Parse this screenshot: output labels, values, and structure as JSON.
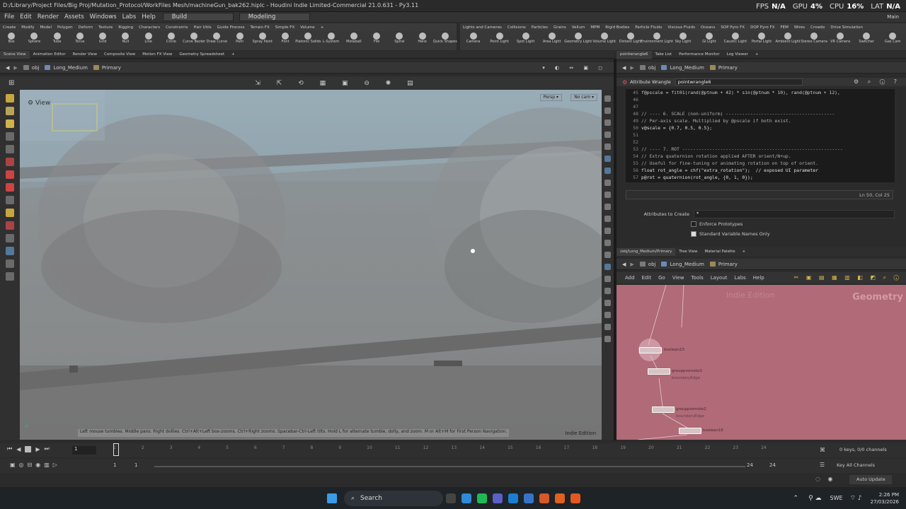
{
  "titlebar": {
    "text": "D:/Library/Project Files/Big Proj/Mutation_Protocol/WorkFiles Mesh/machineGun_bak262.hiplc - Houdini Indie Limited-Commercial 21.0.631 - Py3.11",
    "fps_label": "FPS",
    "fps_value": "N/A",
    "gpu_label": "GPU",
    "gpu_value": "4%",
    "cpu_label": "CPU",
    "cpu_value": "16%",
    "lat_label": "LAT",
    "lat_value": "N/A",
    "main_label": "Main"
  },
  "menu": {
    "items": [
      "File",
      "Edit",
      "Render",
      "Assets",
      "Windows",
      "Labs",
      "Help"
    ],
    "desktop_build": "Build",
    "desktop_modeling": "Modeling"
  },
  "shelf_tabs_left": [
    "Create",
    "Modify",
    "Model",
    "Polygon",
    "Deform",
    "Texture",
    "Rigging",
    "Characters",
    "Constraints",
    "Hair Utils",
    "Guide Process",
    "Terrain FX",
    "Simple FX",
    "Volume"
  ],
  "shelf_tabs_right": [
    "Lights and Cameras",
    "Collisions",
    "Particles",
    "Grains",
    "Vellum",
    "MPM",
    "Rigid Bodies",
    "Particle Fluids",
    "Viscous Fluids",
    "Oceans",
    "SOP Pyro FX",
    "DOP Pyro FX",
    "FEM",
    "Wires",
    "Crowds",
    "Drive Simulation"
  ],
  "shelf_tools_left": [
    "Box",
    "Sphere",
    "Tube",
    "Torus",
    "Grid",
    "Null",
    "Line",
    "Circle",
    "Curve Bezier",
    "Draw Curve",
    "Path",
    "Spray Paint",
    "Font",
    "Platonic Solids",
    "L-System",
    "Metaball",
    "File",
    "Spiral",
    "Helix",
    "Quick Shapes"
  ],
  "shelf_tools_right": [
    "Camera",
    "Point Light",
    "Spot Light",
    "Area Light",
    "Geometry Light",
    "Volume Light",
    "Distant Light",
    "Environment Light",
    "Sky Light",
    "GI Light",
    "Caustic Light",
    "Portal Light",
    "Ambient Light",
    "Stereo Camera",
    "VR Camera",
    "Switcher",
    "Gas Cam"
  ],
  "pane_tabs_left": [
    "Scene View",
    "Animation Editor",
    "Render View",
    "Composite View",
    "Motion FX View",
    "Geometry Spreadsheet"
  ],
  "pane_tabs_right": [
    "pointwrangle6",
    "Take List",
    "Performance Monitor",
    "Log Viewer"
  ],
  "path_left": {
    "obj": "obj",
    "geo": "Long_Medium",
    "ctx": "Primary"
  },
  "path_right": {
    "obj": "obj",
    "geo": "Long_Medium",
    "ctx": "Primary"
  },
  "path_net": {
    "obj": "obj",
    "geo": "Long_Medium",
    "ctx": "Primary"
  },
  "viewport": {
    "view_label": "View",
    "persp": "Persp",
    "cam": "No cam",
    "hint": "Left mouse tumbles. Middle pans. Right dollies. Ctrl+Alt+Left box-zooms. Ctrl+Right zooms. Spacebar-Ctrl-Left tilts. Hold L for alternate tumble, dolly, and zoom. M or Alt+M for First Person Navigation.",
    "edition": "Indie Edition"
  },
  "wrangle": {
    "type": "Attribute Wrangle",
    "name": "pointwrangle6",
    "code_lines": [
      {
        "n": "45",
        "t": "f@pscale = fit01(rand(@ptnum + 42) * sin(@ptnum * 10), rand(@ptnum + 12),"
      },
      {
        "n": "46",
        "t": ""
      },
      {
        "n": "47",
        "t": ""
      },
      {
        "n": "48",
        "t": "// ---- 6. SCALE (non-uniform) ----------------------------------------"
      },
      {
        "n": "49",
        "t": "// Per-axis scale. Multiplied by @pscale if both exist."
      },
      {
        "n": "50",
        "t": "v@scale = {0.7, 0.5, 0.5};"
      },
      {
        "n": "51",
        "t": ""
      },
      {
        "n": "52",
        "t": ""
      },
      {
        "n": "53",
        "t": "// ---- 7. ROT -----------------------------------------------------------"
      },
      {
        "n": "54",
        "t": "// Extra quaternion rotation applied AFTER orient/N+up."
      },
      {
        "n": "55",
        "t": "// Useful for fine-tuning or animating rotation on top of orient."
      },
      {
        "n": "56",
        "t": "float rot_angle = chf(\"extra_rotation\");  // exposed UI parameter"
      },
      {
        "n": "57",
        "t": "p@rot = quaternion(rot_angle, {0, 1, 0});"
      }
    ],
    "cursor_status": "Ln 50, Col 25",
    "attributes_label": "Attributes to Create",
    "attributes_value": "*",
    "enforce_label": "Enforce Prototypes",
    "enforce_checked": false,
    "stdvar_label": "Standard Variable Names Only",
    "stdvar_checked": true
  },
  "net_tabs": [
    "/obj/Long_Medium/Primary",
    "Tree View",
    "Material Palette"
  ],
  "net_menu": [
    "Add",
    "Edit",
    "Go",
    "View",
    "Tools",
    "Layout",
    "Labs",
    "Help"
  ],
  "net": {
    "context_label": "Geometry",
    "watermark": "Indie Edition",
    "nodes": [
      {
        "name": "boolean15",
        "sub": ""
      },
      {
        "name": "grouppromote3",
        "sub": "boundaryEdge"
      },
      {
        "name": "grouppromote2",
        "sub": "boundaryEdge"
      },
      {
        "name": "boolean16",
        "sub": ""
      }
    ]
  },
  "timeline": {
    "frame": "1",
    "ticks": [
      "1",
      "2",
      "3",
      "4",
      "5",
      "6",
      "7",
      "8",
      "9",
      "10",
      "11",
      "12",
      "13",
      "14",
      "15",
      "16",
      "17",
      "18",
      "19",
      "20",
      "21",
      "22",
      "23",
      "24"
    ],
    "start": "1",
    "start2": "1",
    "end": "24",
    "end2": "24",
    "keys": "0 keys, 0/0 channels",
    "key_all": "Key All Channels",
    "auto_update": "Auto Update"
  },
  "taskbar": {
    "search": "Search",
    "lang": "SWE",
    "time": "2:26 PM",
    "date": "27/03/2026"
  }
}
